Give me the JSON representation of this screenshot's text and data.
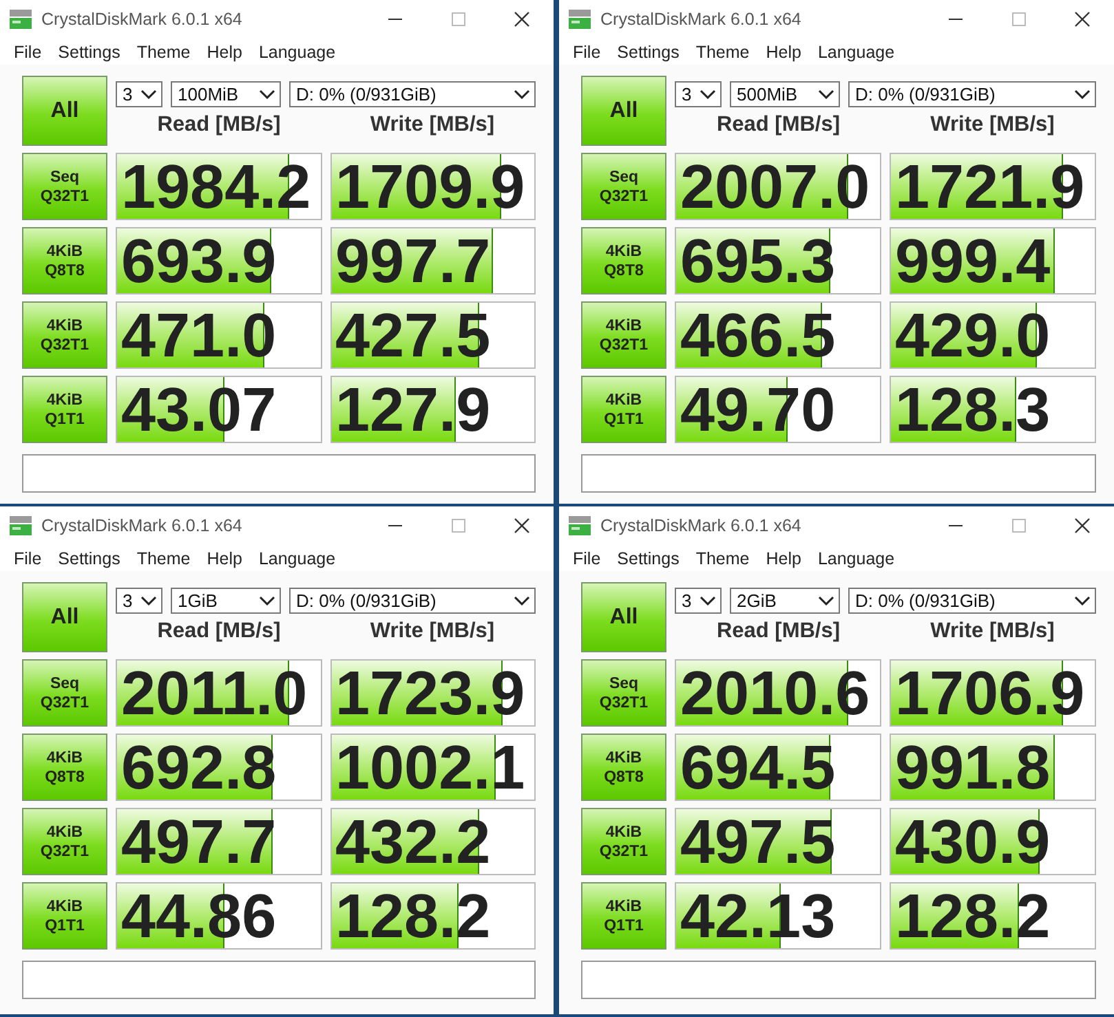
{
  "windows": [
    {
      "title": "CrystalDiskMark 6.0.1 x64",
      "menu": [
        "File",
        "Settings",
        "Theme",
        "Help",
        "Language"
      ],
      "all_button": "All",
      "count": "3",
      "size": "100MiB",
      "drive": "D: 0% (0/931GiB)",
      "read_header": "Read [MB/s]",
      "write_header": "Write [MB/s]",
      "tests": [
        {
          "lines": [
            "Seq",
            "Q32T1"
          ],
          "read": {
            "value": "1984.2",
            "level": 0.84
          },
          "write": {
            "value": "1709.9",
            "level": 0.83
          }
        },
        {
          "lines": [
            "4KiB",
            "Q8T8"
          ],
          "read": {
            "value": "693.9",
            "level": 0.75
          },
          "write": {
            "value": "997.7",
            "level": 0.79
          }
        },
        {
          "lines": [
            "4KiB",
            "Q32T1"
          ],
          "read": {
            "value": "471.0",
            "level": 0.72
          },
          "write": {
            "value": "427.5",
            "level": 0.72
          }
        },
        {
          "lines": [
            "4KiB",
            "Q1T1"
          ],
          "read": {
            "value": "43.07",
            "level": 0.52
          },
          "write": {
            "value": "127.9",
            "level": 0.61
          }
        }
      ]
    },
    {
      "title": "CrystalDiskMark 6.0.1 x64",
      "menu": [
        "File",
        "Settings",
        "Theme",
        "Help",
        "Language"
      ],
      "all_button": "All",
      "count": "3",
      "size": "500MiB",
      "drive": "D: 0% (0/931GiB)",
      "read_header": "Read [MB/s]",
      "write_header": "Write [MB/s]",
      "tests": [
        {
          "lines": [
            "Seq",
            "Q32T1"
          ],
          "read": {
            "value": "2007.0",
            "level": 0.84
          },
          "write": {
            "value": "1721.9",
            "level": 0.84
          }
        },
        {
          "lines": [
            "4KiB",
            "Q8T8"
          ],
          "read": {
            "value": "695.3",
            "level": 0.75
          },
          "write": {
            "value": "999.4",
            "level": 0.8
          }
        },
        {
          "lines": [
            "4KiB",
            "Q32T1"
          ],
          "read": {
            "value": "466.5",
            "level": 0.71
          },
          "write": {
            "value": "429.0",
            "level": 0.71
          }
        },
        {
          "lines": [
            "4KiB",
            "Q1T1"
          ],
          "read": {
            "value": "49.70",
            "level": 0.54
          },
          "write": {
            "value": "128.3",
            "level": 0.61
          }
        }
      ]
    },
    {
      "title": "CrystalDiskMark 6.0.1 x64",
      "menu": [
        "File",
        "Settings",
        "Theme",
        "Help",
        "Language"
      ],
      "all_button": "All",
      "count": "3",
      "size": "1GiB",
      "drive": "D: 0% (0/931GiB)",
      "read_header": "Read [MB/s]",
      "write_header": "Write [MB/s]",
      "tests": [
        {
          "lines": [
            "Seq",
            "Q32T1"
          ],
          "read": {
            "value": "2011.0",
            "level": 0.84
          },
          "write": {
            "value": "1723.9",
            "level": 0.84
          }
        },
        {
          "lines": [
            "4KiB",
            "Q8T8"
          ],
          "read": {
            "value": "692.8",
            "level": 0.76
          },
          "write": {
            "value": "1002.1",
            "level": 0.8
          }
        },
        {
          "lines": [
            "4KiB",
            "Q32T1"
          ],
          "read": {
            "value": "497.7",
            "level": 0.76
          },
          "write": {
            "value": "432.2",
            "level": 0.72
          }
        },
        {
          "lines": [
            "4KiB",
            "Q1T1"
          ],
          "read": {
            "value": "44.86",
            "level": 0.52
          },
          "write": {
            "value": "128.2",
            "level": 0.62
          }
        }
      ]
    },
    {
      "title": "CrystalDiskMark 6.0.1 x64",
      "menu": [
        "File",
        "Settings",
        "Theme",
        "Help",
        "Language"
      ],
      "all_button": "All",
      "count": "3",
      "size": "2GiB",
      "drive": "D: 0% (0/931GiB)",
      "read_header": "Read [MB/s]",
      "write_header": "Write [MB/s]",
      "tests": [
        {
          "lines": [
            "Seq",
            "Q32T1"
          ],
          "read": {
            "value": "2010.6",
            "level": 0.84
          },
          "write": {
            "value": "1706.9",
            "level": 0.84
          }
        },
        {
          "lines": [
            "4KiB",
            "Q8T8"
          ],
          "read": {
            "value": "694.5",
            "level": 0.75
          },
          "write": {
            "value": "991.8",
            "level": 0.8
          }
        },
        {
          "lines": [
            "4KiB",
            "Q32T1"
          ],
          "read": {
            "value": "497.5",
            "level": 0.76
          },
          "write": {
            "value": "430.9",
            "level": 0.72
          }
        },
        {
          "lines": [
            "4KiB",
            "Q1T1"
          ],
          "read": {
            "value": "42.13",
            "level": 0.51
          },
          "write": {
            "value": "128.2",
            "level": 0.62
          }
        }
      ]
    }
  ]
}
